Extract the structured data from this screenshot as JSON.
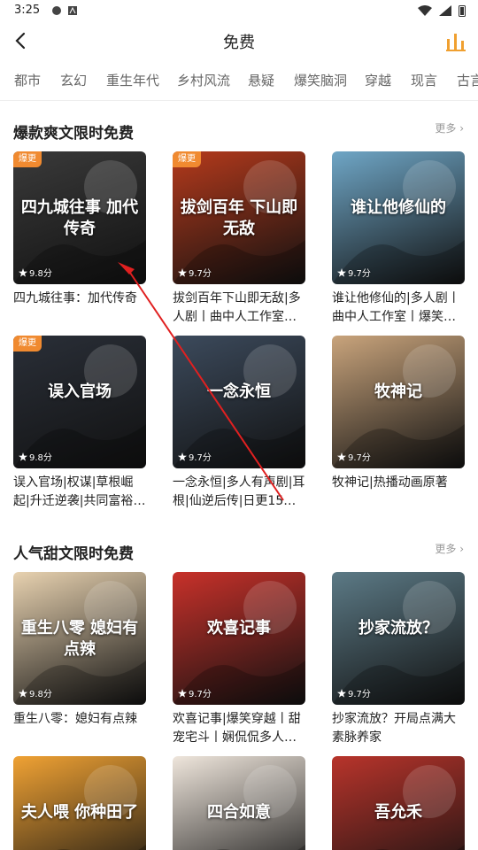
{
  "status": {
    "time": "3:25"
  },
  "header": {
    "title": "免费"
  },
  "tabs": [
    "都市",
    "玄幻",
    "重生年代",
    "乡村风流",
    "悬疑",
    "爆笑脑洞",
    "穿越",
    "现言",
    "古言"
  ],
  "sections": [
    {
      "title": "爆款爽文限时免费",
      "more": "更多 ›",
      "books": [
        {
          "title": "四九城往事：加代传奇",
          "rating": "9.8分",
          "badge": "爆更",
          "cover_color": "#3a3a3a",
          "cover_text": "四九城往事 加代传奇"
        },
        {
          "title": "拔剑百年下山即无敌|多人剧丨曲中人工作室丨...",
          "rating": "9.7分",
          "badge": "爆更",
          "cover_color": "#b53a1c",
          "cover_text": "拔剑百年 下山即无敌"
        },
        {
          "title": "谁让他修仙的|多人剧丨曲中人工作室丨爆笑修...",
          "rating": "9.7分",
          "badge": "",
          "cover_color": "#6fa6c6",
          "cover_text": "谁让他修仙的"
        },
        {
          "title": "误入官场|权谋|草根崛起|升迁逆袭|共同富裕|单...",
          "rating": "9.8分",
          "badge": "爆更",
          "cover_color": "#2a2f38",
          "cover_text": "误入官场"
        },
        {
          "title": "一念永恒|多人有声剧|耳根|仙逆后传|日更15集|...",
          "rating": "9.7分",
          "badge": "",
          "cover_color": "#3c4a5c",
          "cover_text": "一念永恒"
        },
        {
          "title": "牧神记|热播动画原著",
          "rating": "9.7分",
          "badge": "",
          "cover_color": "#c9a47c",
          "cover_text": "牧神记"
        }
      ]
    },
    {
      "title": "人气甜文限时免费",
      "more": "更多 ›",
      "books": [
        {
          "title": "重生八零：媳妇有点辣",
          "rating": "9.8分",
          "badge": "",
          "cover_color": "#e8d2b0",
          "cover_text": "重生八零 媳妇有点辣"
        },
        {
          "title": "欢喜记事|爆笑穿越丨甜宠宅斗丨娴侃侃多人有...",
          "rating": "9.7分",
          "badge": "",
          "cover_color": "#c8312a",
          "cover_text": "欢喜记事"
        },
        {
          "title": "抄家流放？开局点满大素脉养家",
          "rating": "9.7分",
          "badge": "",
          "cover_color": "#5c7a86",
          "cover_text": "抄家流放？"
        },
        {
          "title": "",
          "rating": "",
          "badge": "",
          "cover_color": "#f0a234",
          "cover_text": "夫人喂 你种田了"
        },
        {
          "title": "",
          "rating": "",
          "badge": "",
          "cover_color": "#efe6dc",
          "cover_text": "四合如意"
        },
        {
          "title": "",
          "rating": "",
          "badge": "",
          "cover_color": "#b8342b",
          "cover_text": "吾允禾"
        }
      ]
    }
  ]
}
